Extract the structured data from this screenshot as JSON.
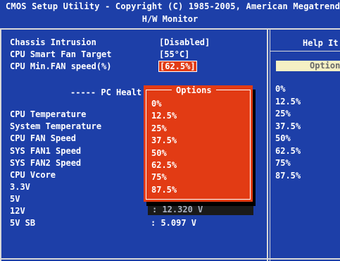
{
  "header": {
    "title": "CMOS Setup Utility - Copyright (C) 1985-2005, American Megatrends",
    "subtitle": "H/W Monitor"
  },
  "settings": [
    {
      "label": "Chassis Intrusion",
      "value": "[Disabled]"
    },
    {
      "label": "CPU Smart Fan Target",
      "value": "[55°C]"
    },
    {
      "label": "CPU Min.FAN speed(%)",
      "value": "[62.5%]"
    }
  ],
  "section_title": "----- PC Healt",
  "monitor": [
    {
      "label": "CPU Temperature"
    },
    {
      "label": "System Temperature"
    },
    {
      "label": "CPU FAN Speed"
    },
    {
      "label": "SYS FAN1 Speed"
    },
    {
      "label": "SYS FAN2 Speed"
    },
    {
      "label": "CPU Vcore"
    },
    {
      "label": "3.3V"
    },
    {
      "label": "5V"
    },
    {
      "label": "12V",
      "value": ": 12.320 V"
    },
    {
      "label": "5V SB",
      "value": ": 5.097 V"
    }
  ],
  "popup": {
    "title": "Options",
    "items": [
      "0%",
      "12.5%",
      "25%",
      "37.5%",
      "50%",
      "62.5%",
      "75%",
      "87.5%"
    ]
  },
  "help": {
    "title": "Help It",
    "option_label": "Option",
    "list": [
      "0%",
      "12.5%",
      "25%",
      "37.5%",
      "50%",
      "62.5%",
      "75%",
      "87.5%"
    ]
  },
  "colors": {
    "background": "#1d3fa8",
    "popup": "#e23b14",
    "frame": "#d8d8d8",
    "help_option_bg": "#f5f0c4"
  }
}
